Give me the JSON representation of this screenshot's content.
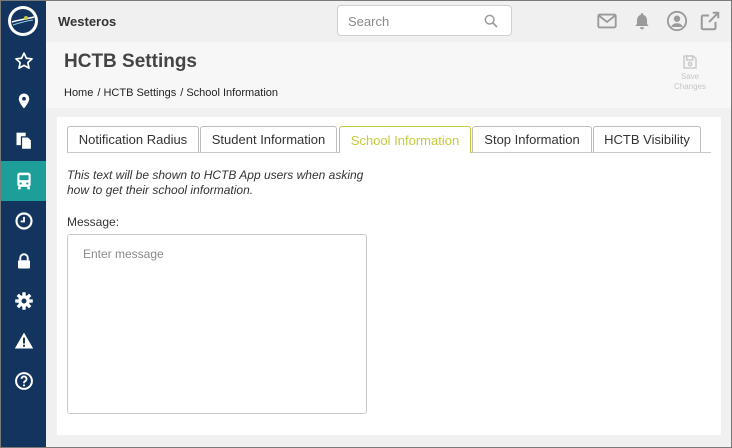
{
  "app": {
    "name": "Westeros"
  },
  "search": {
    "placeholder": "Search"
  },
  "sidebar": {
    "items": [
      {
        "icon": "star-icon"
      },
      {
        "icon": "map-marker-icon"
      },
      {
        "icon": "copy-icon"
      },
      {
        "icon": "bus-icon",
        "active": true
      },
      {
        "icon": "clock-icon"
      },
      {
        "icon": "lock-icon"
      },
      {
        "icon": "gear-icon"
      },
      {
        "icon": "warning-icon"
      },
      {
        "icon": "help-icon"
      }
    ]
  },
  "topbar": {
    "icons": [
      "mail-icon",
      "bell-icon",
      "user-icon",
      "external-link-icon"
    ]
  },
  "header": {
    "title": "HCTB Settings",
    "breadcrumb": [
      "Home",
      "/ HCTB Settings",
      "/ School Information"
    ],
    "save_line1": "Save",
    "save_line2": "Changes"
  },
  "tabs": [
    {
      "label": "Notification Radius"
    },
    {
      "label": "Student Information"
    },
    {
      "label": "School Information",
      "active": true
    },
    {
      "label": "Stop Information"
    },
    {
      "label": "HCTB Visibility"
    }
  ],
  "school_info": {
    "description": "This text will be shown to HCTB App users when asking how to get their school information.",
    "message_label": "Message:",
    "message_value": "",
    "message_placeholder": "Enter message"
  },
  "colors": {
    "sidebar_bg": "#12345e",
    "sidebar_active": "#1e9e99",
    "tab_active": "#c5cb3a"
  }
}
